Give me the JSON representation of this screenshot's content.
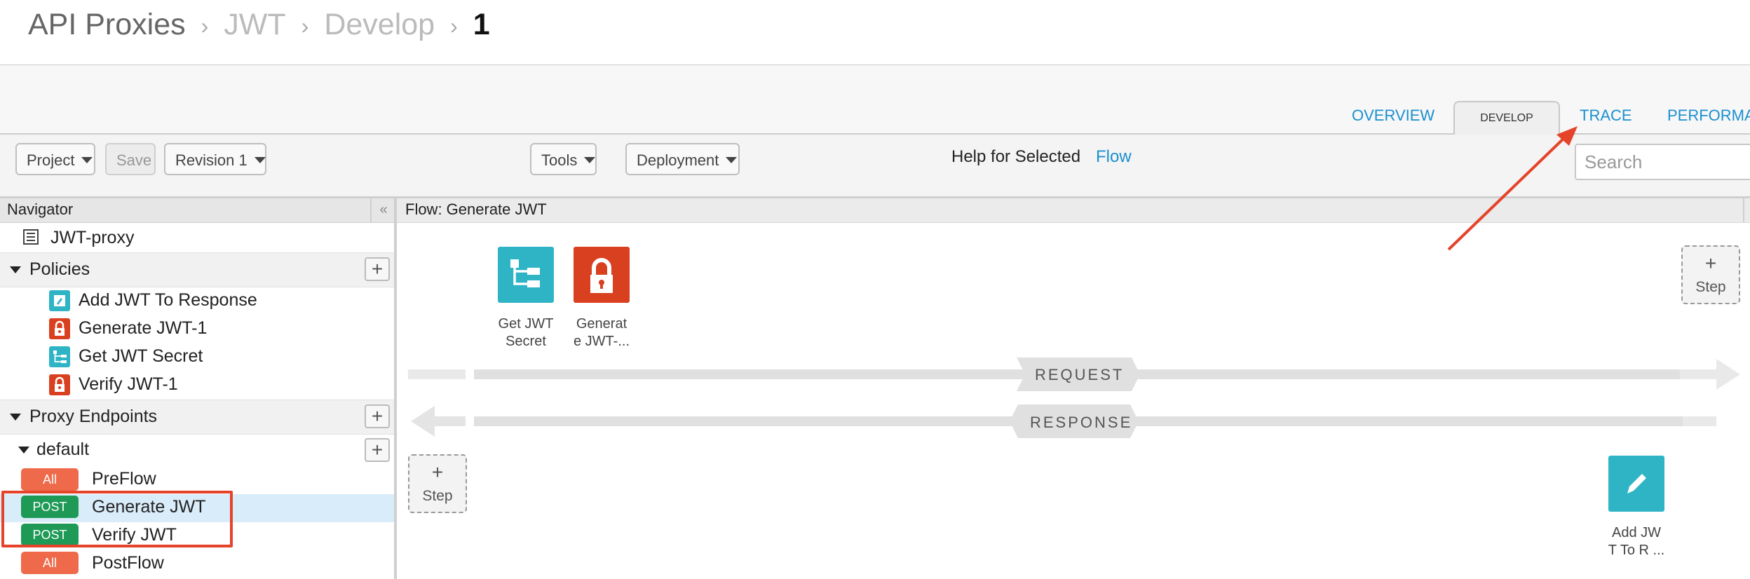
{
  "breadcrumb": {
    "items": [
      "API Proxies",
      "JWT",
      "Develop",
      "1"
    ],
    "separator": "›"
  },
  "tabs": [
    "OVERVIEW",
    "DEVELOP",
    "TRACE",
    "PERFORMA"
  ],
  "toolbar": {
    "project": "Project",
    "save": "Save",
    "revision": "Revision 1",
    "tools": "Tools",
    "deployment": "Deployment",
    "help_text": "Help for Selected",
    "help_link": "Flow",
    "search_placeholder": "Search"
  },
  "navigator": {
    "title": "Navigator",
    "collapse": "«",
    "proxy_name": "JWT-proxy",
    "policies_label": "Policies",
    "policies": [
      {
        "label": "Add JWT To Response",
        "icon": "edit-icon"
      },
      {
        "label": "Generate JWT-1",
        "icon": "lock-icon"
      },
      {
        "label": "Get JWT Secret",
        "icon": "flow-tree-icon"
      },
      {
        "label": "Verify JWT-1",
        "icon": "lock-icon"
      }
    ],
    "proxy_endpoints_label": "Proxy Endpoints",
    "endpoint": "default",
    "flows": [
      {
        "method": "All",
        "label": "PreFlow"
      },
      {
        "method": "POST",
        "label": "Generate JWT"
      },
      {
        "method": "POST",
        "label": "Verify JWT"
      },
      {
        "method": "All",
        "label": "PostFlow"
      }
    ]
  },
  "flow": {
    "title": "Flow: Generate JWT",
    "request_label": "REQUEST",
    "response_label": "RESPONSE",
    "step_plus": "+",
    "step_label": "Step",
    "request_steps": [
      {
        "line1": "Get JWT",
        "line2": "Secret",
        "icon": "flow-tree-icon"
      },
      {
        "line1": "Generat",
        "line2": "e JWT-...",
        "icon": "lock-icon"
      }
    ],
    "response_steps": [
      {
        "line1": "Add JW",
        "line2": "T To R ...",
        "icon": "edit-icon"
      }
    ]
  },
  "colors": {
    "link": "#1a8fd1",
    "teal": "#2fb4c6",
    "red": "#d9401f",
    "post_badge": "#1e9a56",
    "all_badge": "#ef6a4b",
    "annotation": "#e5432a",
    "selected_row": "#d9ecf9"
  }
}
